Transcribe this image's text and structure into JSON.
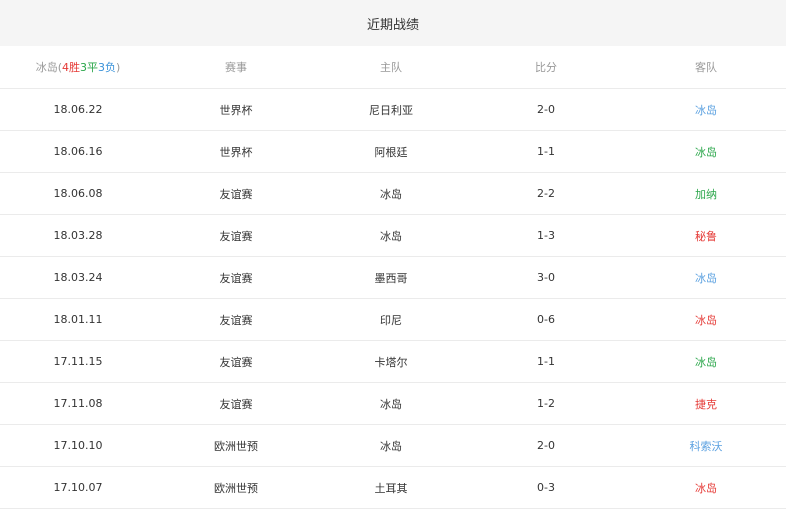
{
  "title": "近期战绩",
  "summary": {
    "team": "冰岛",
    "open": "(",
    "wins": "4胜",
    "draws": "3平",
    "losses": "3负",
    "close": ")"
  },
  "headers": {
    "competition": "赛事",
    "home": "主队",
    "score": "比分",
    "away": "客队"
  },
  "colors": {
    "blue": "#5aa0e0",
    "green": "#2aa64a",
    "red": "#e53935"
  },
  "matches": [
    {
      "date": "18.06.22",
      "competition": "世界杯",
      "home": "尼日利亚",
      "score": "2-0",
      "away": "冰岛",
      "away_color": "blue"
    },
    {
      "date": "18.06.16",
      "competition": "世界杯",
      "home": "阿根廷",
      "score": "1-1",
      "away": "冰岛",
      "away_color": "green"
    },
    {
      "date": "18.06.08",
      "competition": "友谊赛",
      "home": "冰岛",
      "score": "2-2",
      "away": "加纳",
      "away_color": "green"
    },
    {
      "date": "18.03.28",
      "competition": "友谊赛",
      "home": "冰岛",
      "score": "1-3",
      "away": "秘鲁",
      "away_color": "red"
    },
    {
      "date": "18.03.24",
      "competition": "友谊赛",
      "home": "墨西哥",
      "score": "3-0",
      "away": "冰岛",
      "away_color": "blue"
    },
    {
      "date": "18.01.11",
      "competition": "友谊赛",
      "home": "印尼",
      "score": "0-6",
      "away": "冰岛",
      "away_color": "red"
    },
    {
      "date": "17.11.15",
      "competition": "友谊赛",
      "home": "卡塔尔",
      "score": "1-1",
      "away": "冰岛",
      "away_color": "green"
    },
    {
      "date": "17.11.08",
      "competition": "友谊赛",
      "home": "冰岛",
      "score": "1-2",
      "away": "捷克",
      "away_color": "red"
    },
    {
      "date": "17.10.10",
      "competition": "欧洲世预",
      "home": "冰岛",
      "score": "2-0",
      "away": "科索沃",
      "away_color": "blue"
    },
    {
      "date": "17.10.07",
      "competition": "欧洲世预",
      "home": "土耳其",
      "score": "0-3",
      "away": "冰岛",
      "away_color": "red"
    }
  ]
}
